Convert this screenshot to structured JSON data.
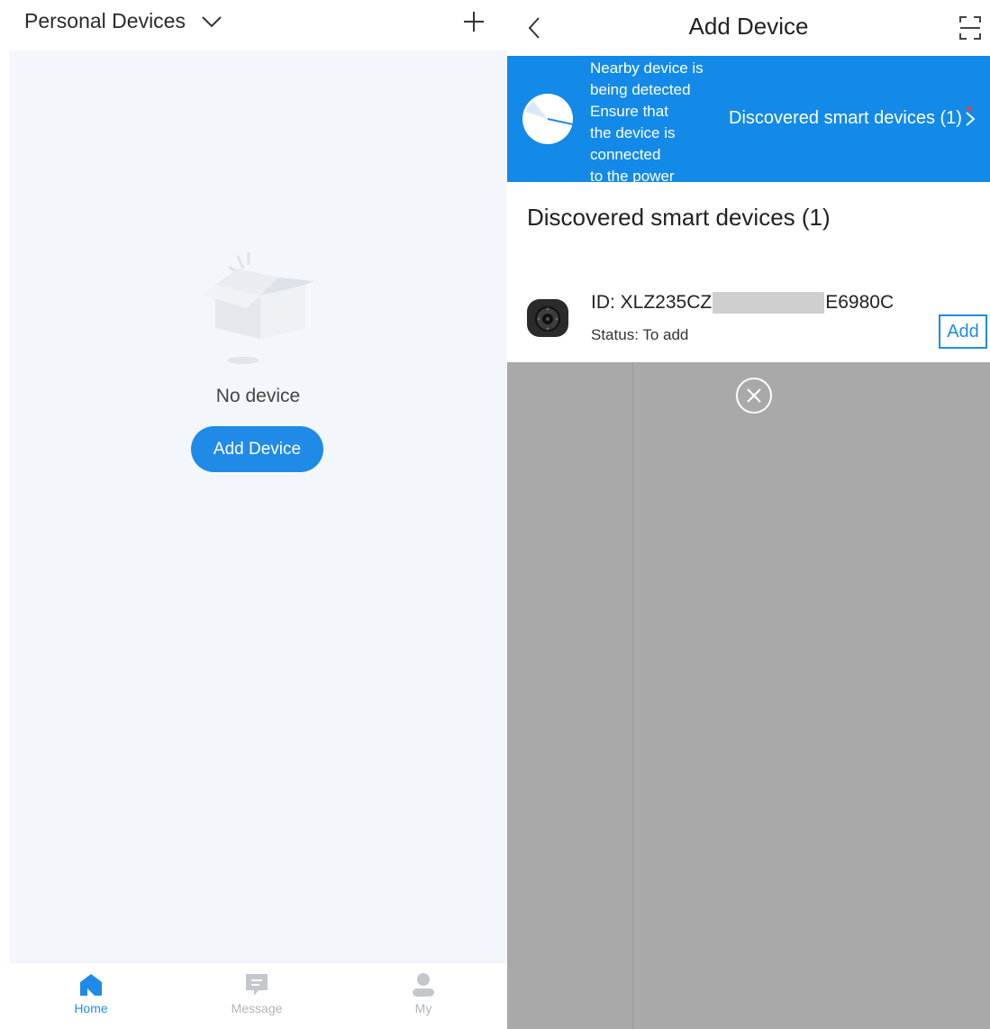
{
  "left": {
    "header_title": "Personal Devices",
    "empty_text": "No device",
    "add_button": "Add Device",
    "tabs": [
      {
        "label": "Home",
        "icon": "home-icon",
        "active": true
      },
      {
        "label": "Message",
        "icon": "message-icon",
        "active": false
      },
      {
        "label": "My",
        "icon": "person-icon",
        "active": false
      }
    ]
  },
  "right": {
    "title": "Add Device",
    "banner": {
      "lines": [
        "Nearby device is",
        "being detected",
        "Ensure that",
        "the device is",
        "connected",
        "to the power"
      ],
      "link": "Discovered smart devices (1)"
    },
    "section_title": "Discovered smart devices (1)",
    "device": {
      "id_prefix": "ID: XLZ235CZ",
      "id_suffix": "E6980C",
      "status": "Status: To add",
      "add_label": "Add"
    }
  },
  "colors": {
    "accent": "#1f8be6",
    "banner": "#138ae8",
    "overlay": "#a9a9a9",
    "empty_bg": "#f3f6fa"
  }
}
